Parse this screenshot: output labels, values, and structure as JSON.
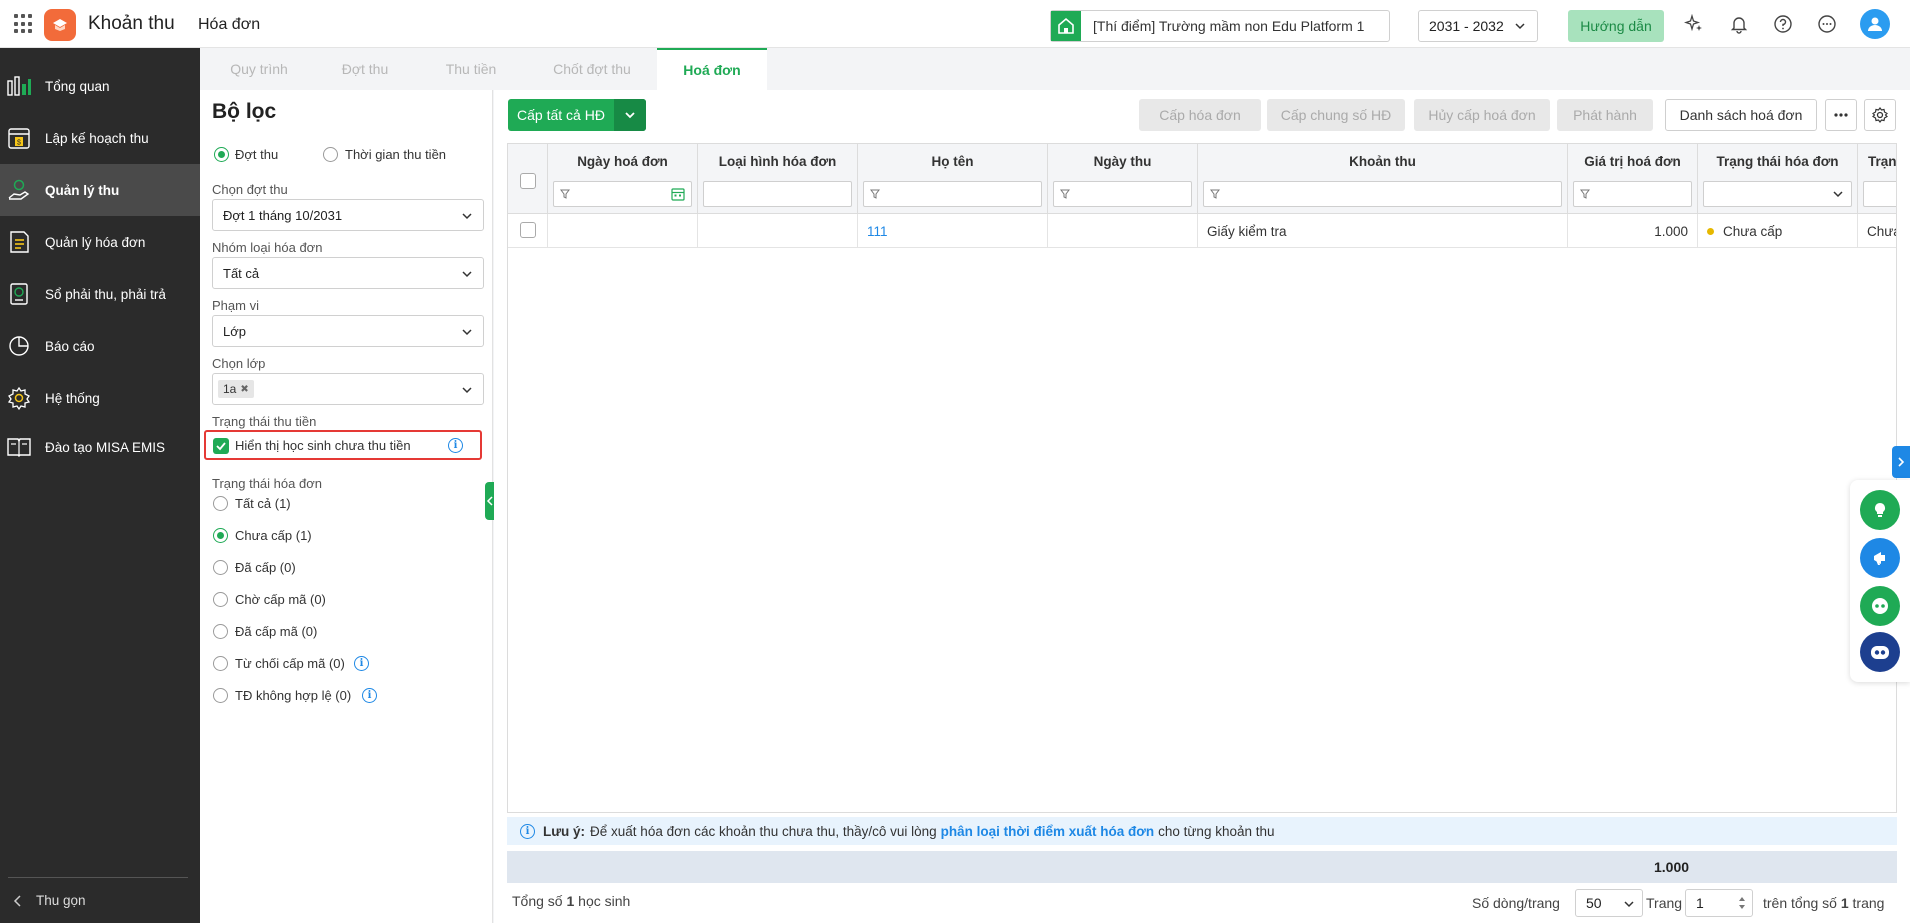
{
  "app": {
    "title": "Khoản thu",
    "page_title": "Hóa đơn",
    "school": "[Thí điểm] Trường mầm non Edu Platform 1",
    "year": "2031 - 2032",
    "guide_label": "Hướng dẫn"
  },
  "sidebar": {
    "items": [
      {
        "label": "Tổng quan",
        "icon": "bar-chart-icon"
      },
      {
        "label": "Lập kế hoạch thu",
        "icon": "calendar-money-icon"
      },
      {
        "label": "Quản lý thu",
        "icon": "hand-coin-icon",
        "active": true
      },
      {
        "label": "Quản lý hóa đơn",
        "icon": "invoice-icon"
      },
      {
        "label": "Sổ phải thu, phải trả",
        "icon": "ledger-icon"
      },
      {
        "label": "Báo cáo",
        "icon": "pie-chart-icon"
      },
      {
        "label": "Hệ thống",
        "icon": "gear-icon"
      },
      {
        "label": "Đào tạo MISA EMIS",
        "icon": "book-icon"
      }
    ],
    "collapse_label": "Thu gọn"
  },
  "tabs": [
    {
      "label": "Quy trình"
    },
    {
      "label": "Đợt thu"
    },
    {
      "label": "Thu tiền"
    },
    {
      "label": "Chốt đợt thu"
    },
    {
      "label": "Hoá đơn",
      "active": true
    }
  ],
  "filter": {
    "title": "Bộ lọc",
    "mode_options": [
      "Đợt thu",
      "Thời gian thu tiền"
    ],
    "mode_selected": "Đợt thu",
    "period_label": "Chọn đợt thu",
    "period_value": "Đợt 1 tháng 10/2031",
    "invoice_group_label": "Nhóm loại hóa đơn",
    "invoice_group_value": "Tất cả",
    "scope_label": "Phạm vi",
    "scope_value": "Lớp",
    "class_label": "Chọn lớp",
    "class_tag": "1a",
    "payment_status_label": "Trạng thái thu tiền",
    "show_unpaid_label": "Hiển thị học sinh chưa thu tiền",
    "show_unpaid_checked": true,
    "invoice_status_label": "Trạng thái hóa đơn",
    "invoice_status_options": [
      {
        "label": "Tất cả (1)"
      },
      {
        "label": "Chưa cấp (1)",
        "selected": true
      },
      {
        "label": "Đã cấp (0)"
      },
      {
        "label": "Chờ cấp mã (0)"
      },
      {
        "label": "Đã cấp mã (0)"
      },
      {
        "label": "Từ chối cấp mã (0)",
        "info": true
      },
      {
        "label": "TĐ không hợp lệ (0)",
        "info": true
      }
    ]
  },
  "toolbar": {
    "issue_all": "Cấp tất cả HĐ",
    "issue": "Cấp hóa đơn",
    "issue_common": "Cấp chung số HĐ",
    "cancel_issue": "Hủy cấp hoá đơn",
    "publish": "Phát hành",
    "invoice_list": "Danh sách hoá đơn"
  },
  "table": {
    "columns": [
      "Ngày hoá đơn",
      "Loại hình hóa đơn",
      "Họ tên",
      "Ngày thu",
      "Khoản thu",
      "Giá trị hoá đơn",
      "Trạng thái hóa đơn",
      "Trạng"
    ],
    "rows": [
      {
        "invoice_date": "",
        "invoice_type": "",
        "name": "111",
        "pay_date": "",
        "fee": "Giấy kiểm tra",
        "amount": "1.000",
        "status": "Chưa cấp",
        "status_extra": "Chưa",
        "status_color": "#e6b800"
      }
    ]
  },
  "note": {
    "prefix": "Lưu ý:",
    "text_before": "Để xuất hóa đơn các khoản thu chưa thu, thầy/cô vui lòng",
    "link": "phân loại thời điểm xuất hóa đơn",
    "text_after": "cho từng khoản thu"
  },
  "total": {
    "amount": "1.000"
  },
  "footer": {
    "total_prefix": "Tổng số",
    "total_count": "1",
    "total_suffix": "học sinh",
    "rows_per_page_label": "Số dòng/trang",
    "rows_per_page": "50",
    "page_label": "Trang",
    "page": "1",
    "of_total_prefix": "trên tổng số",
    "of_total": "1",
    "of_total_suffix": "trang"
  },
  "colors": {
    "primary_green": "#1faa55",
    "sidebar_bg": "#2b2b2b",
    "link_blue": "#1e88e5",
    "highlight_red": "#e53935"
  }
}
